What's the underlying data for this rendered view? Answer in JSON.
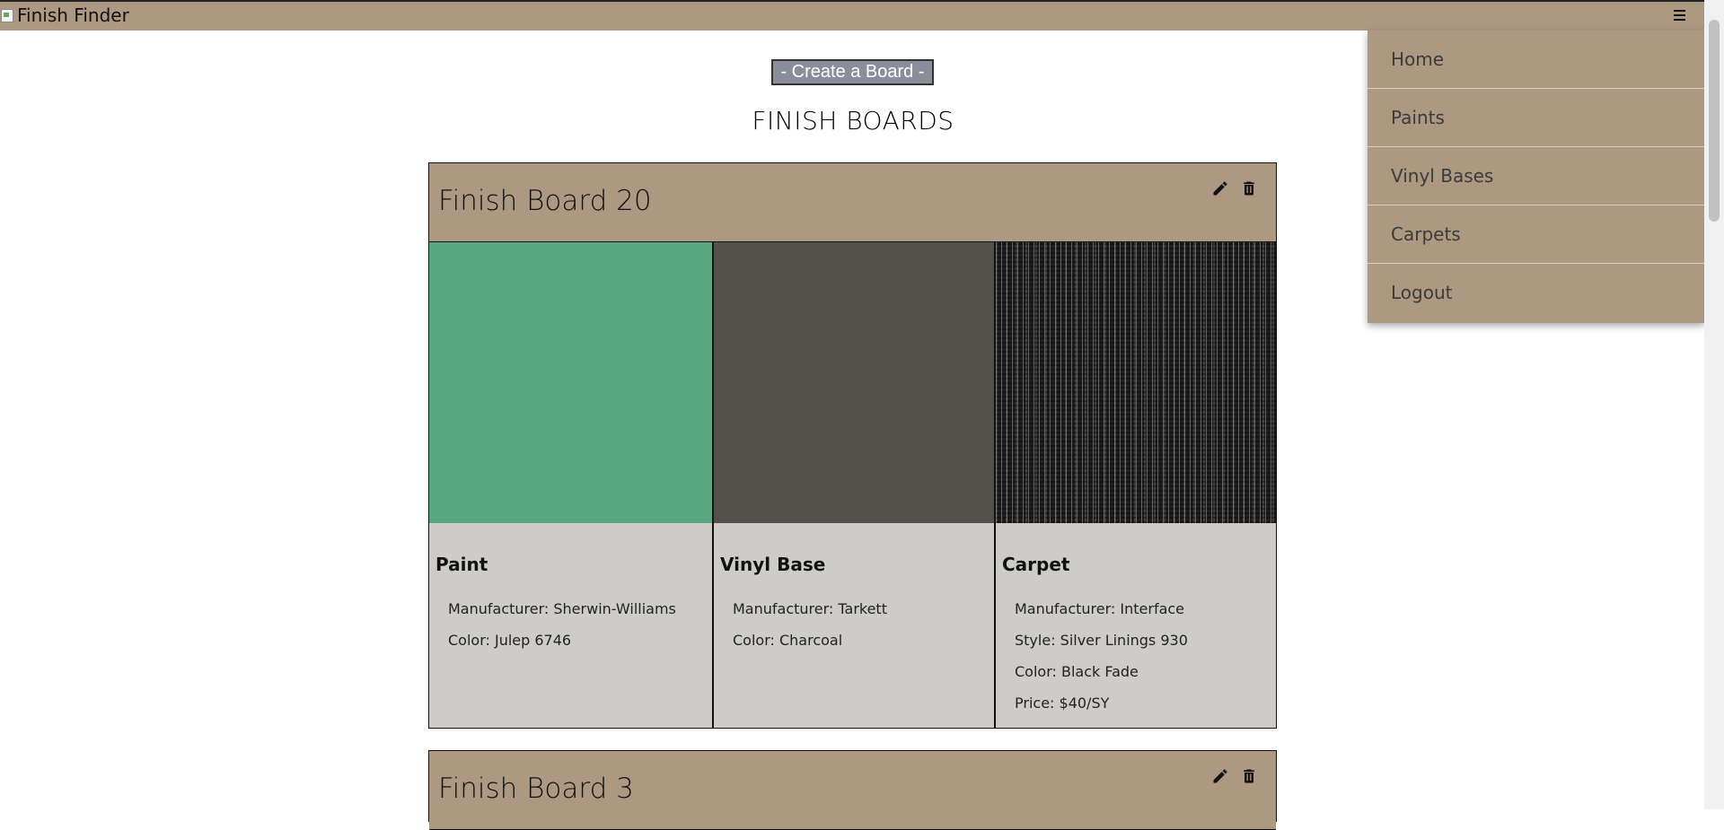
{
  "header": {
    "brand_alt": "Finish Finder",
    "menu_icon": "hamburger-menu-icon"
  },
  "menu": {
    "items": [
      {
        "label": "Home"
      },
      {
        "label": "Paints"
      },
      {
        "label": "Vinyl Bases"
      },
      {
        "label": "Carpets"
      },
      {
        "label": "Logout"
      }
    ]
  },
  "main": {
    "create_button": "- Create a Board -",
    "title": "FINISH BOARDS"
  },
  "boards": [
    {
      "title": "Finish Board 20",
      "items": [
        {
          "type": "Paint",
          "swatch_color": "#57a880",
          "specs": [
            "Manufacturer: Sherwin-Williams",
            "Color: Julep 6746"
          ]
        },
        {
          "type": "Vinyl Base",
          "swatch_color": "#52514c",
          "specs": [
            "Manufacturer: Tarkett",
            "Color: Charcoal"
          ]
        },
        {
          "type": "Carpet",
          "swatch_color": "#1e1e1e",
          "specs": [
            "Manufacturer: Interface",
            "Style: Silver Linings 930",
            "Color: Black Fade",
            "Price: $40/SY"
          ]
        }
      ]
    },
    {
      "title": "Finish Board 3"
    }
  ],
  "colors": {
    "accent": "#ad9882",
    "card_body": "#cdccc8",
    "button": "#8a8e9b"
  }
}
